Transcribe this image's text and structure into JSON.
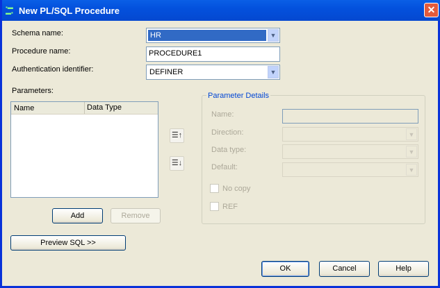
{
  "window": {
    "title": "New PL/SQL Procedure",
    "icon": "sql-procedure-icon",
    "close_icon": "close-icon"
  },
  "form": {
    "schema_label": "Schema name:",
    "schema_value": "HR",
    "procedure_label": "Procedure name:",
    "procedure_value": "PROCEDURE1",
    "auth_label": "Authentication identifier:",
    "auth_value": "DEFINER"
  },
  "parameters": {
    "label": "Parameters:",
    "columns": [
      "Name",
      "Data Type"
    ],
    "rows": [],
    "add": "Add",
    "remove": "Remove",
    "move_up_icon": "move-up-icon",
    "move_down_icon": "move-down-icon"
  },
  "details": {
    "title": "Parameter Details",
    "name_label": "Name:",
    "direction_label": "Direction:",
    "datatype_label": "Data type:",
    "default_label": "Default:",
    "nocopy_label": "No copy",
    "ref_label": "REF"
  },
  "buttons": {
    "preview": "Preview SQL >>",
    "ok": "OK",
    "cancel": "Cancel",
    "help": "Help"
  }
}
